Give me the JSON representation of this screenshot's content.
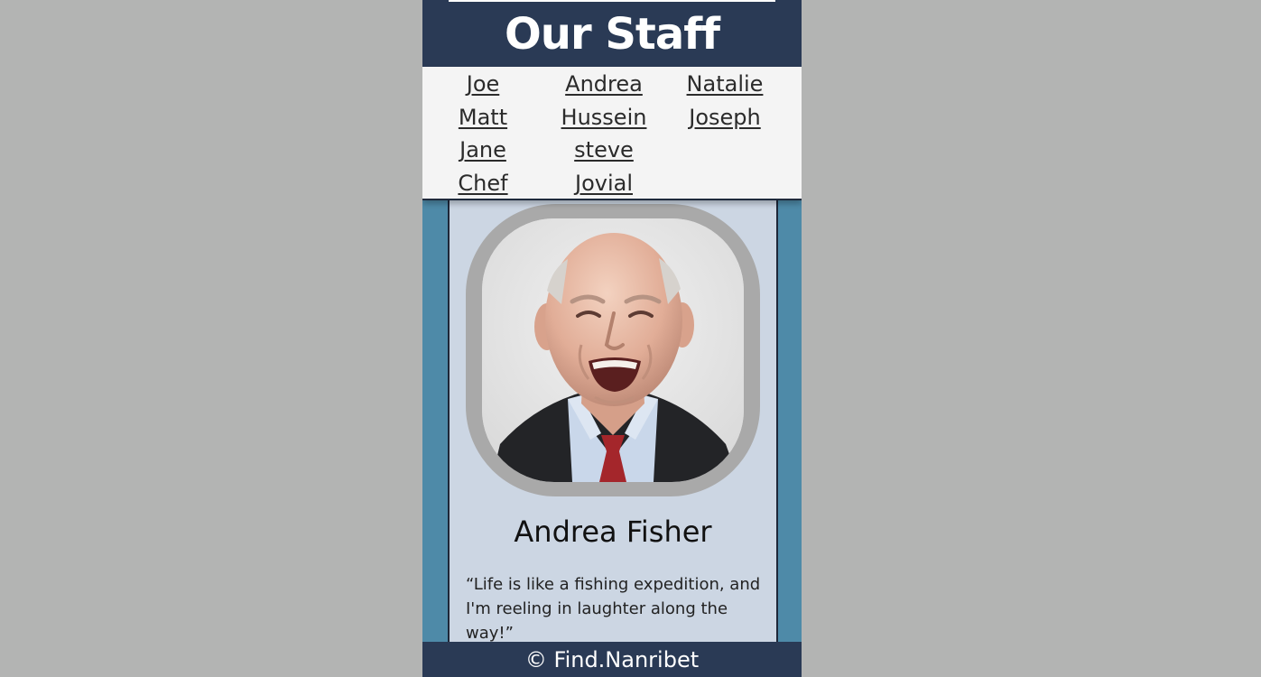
{
  "header": {
    "title": "Our Staff"
  },
  "nav": {
    "columns": [
      [
        "Joe",
        "Matt",
        "Jane",
        "Chef"
      ],
      [
        "Andrea",
        "Hussein",
        "steve",
        "Jovial"
      ],
      [
        "Natalie",
        "Joseph"
      ]
    ]
  },
  "profile": {
    "name": "Andrea Fisher",
    "quote": "“Life is like a fishing expedition, and I'm reeling in laughter along the way!”",
    "photo_icon": "smiling-elderly-man-portrait"
  },
  "footer": {
    "text": "© Find.Nanribet"
  },
  "colors": {
    "header_bg": "#2a3a55",
    "page_bg": "#b3b4b3",
    "side_bg": "#4e8aa8",
    "card_bg": "#ccd6e3",
    "nav_bg": "#f4f4f4"
  }
}
